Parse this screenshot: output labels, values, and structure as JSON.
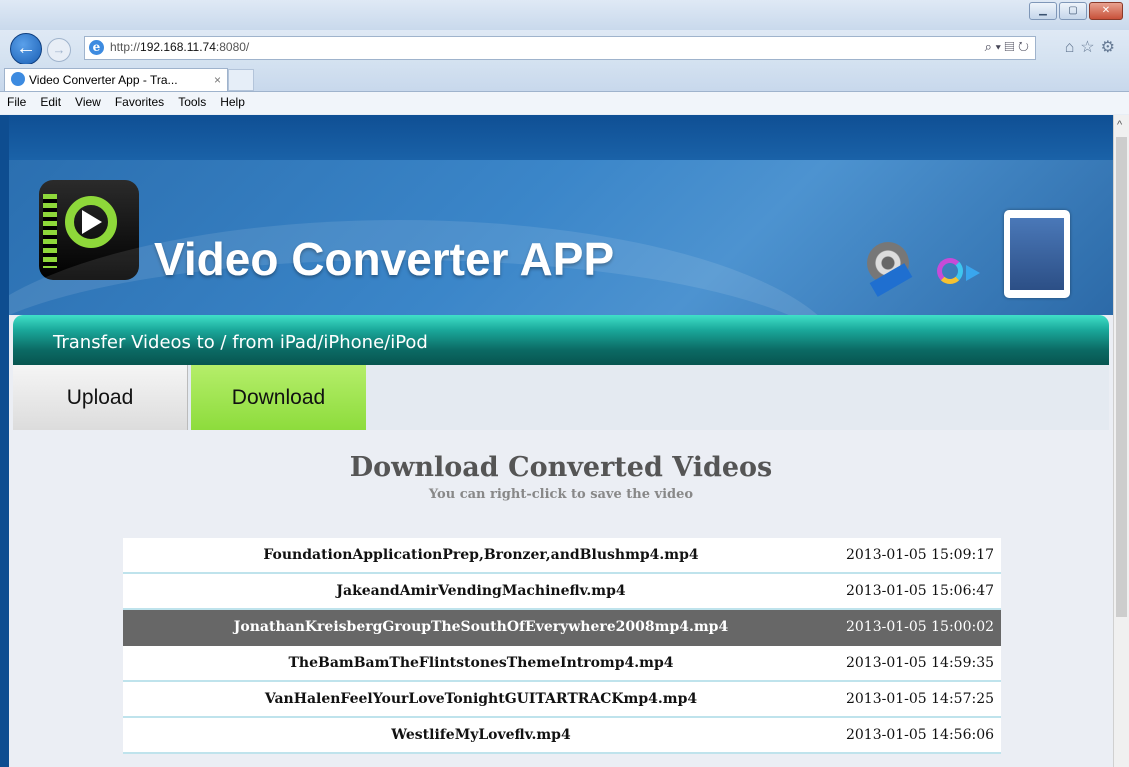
{
  "browser": {
    "url_prefix": "http://",
    "url_host": "192.168.11.74",
    "url_suffix": ":8080/",
    "tab_title": "Video Converter App - Tra...",
    "tab_close": "×",
    "menu": [
      "File",
      "Edit",
      "View",
      "Favorites",
      "Tools",
      "Help"
    ],
    "addr_tools": "⌕ ▾ ▤ ↻",
    "nav_icons": "⌂☆⚙"
  },
  "app": {
    "title": "Video Converter APP",
    "subtitle": "Transfer Videos to / from iPad/iPhone/iPod",
    "tabs": {
      "upload": "Upload",
      "download": "Download",
      "active": "download"
    },
    "accent_green": "#8ddc3c",
    "header_blue": "#2b6fb0"
  },
  "download": {
    "heading": "Download Converted Videos",
    "hint": "You can right-click to save the video",
    "files": [
      {
        "name": "FoundationApplicationPrep,Bronzer,andBlushmp4.mp4",
        "date": "2013-01-05 15:09:17",
        "selected": false
      },
      {
        "name": "JakeandAmirVendingMachineflv.mp4",
        "date": "2013-01-05 15:06:47",
        "selected": false
      },
      {
        "name": "JonathanKreisbergGroupTheSouthOfEverywhere2008mp4.mp4",
        "date": "2013-01-05 15:00:02",
        "selected": true
      },
      {
        "name": "TheBamBamTheFlintstonesThemeIntromp4.mp4",
        "date": "2013-01-05 14:59:35",
        "selected": false
      },
      {
        "name": "VanHalenFeelYourLoveTonightGUITARTRACKmp4.mp4",
        "date": "2013-01-05 14:57:25",
        "selected": false
      },
      {
        "name": "WestlifeMyLoveflv.mp4",
        "date": "2013-01-05 14:56:06",
        "selected": false
      }
    ]
  }
}
